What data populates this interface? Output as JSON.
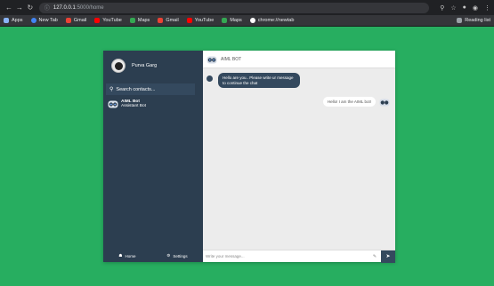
{
  "browser": {
    "url_host": "127.0.0.1",
    "url_path": ":5000/home",
    "bookmarks": [
      {
        "label": "Apps",
        "icon": "apps-grid-icon",
        "color": "#8ab4f8"
      },
      {
        "label": "New Tab",
        "icon": "chrome-icon",
        "color": "#4285f4"
      },
      {
        "label": "Gmail",
        "icon": "gmail-icon",
        "color": "#ea4335"
      },
      {
        "label": "YouTube",
        "icon": "youtube-icon",
        "color": "#ff0000"
      },
      {
        "label": "Maps",
        "icon": "maps-icon",
        "color": "#34a853"
      },
      {
        "label": "Gmail",
        "icon": "gmail-icon",
        "color": "#ea4335"
      },
      {
        "label": "YouTube",
        "icon": "youtube-icon",
        "color": "#ff0000"
      },
      {
        "label": "Maps",
        "icon": "maps-icon",
        "color": "#34a853"
      },
      {
        "label": "chrome://newtab",
        "icon": "github-icon",
        "color": "#ffffff"
      }
    ],
    "reading_list": "Reading list"
  },
  "sidebar": {
    "profile_name": "Purva Garg",
    "search_placeholder": "Search contacts...",
    "contact": {
      "name": "AIML Bot",
      "subtitle": "Assistant Bot"
    },
    "footer": {
      "home": "Home",
      "settings": "Settings"
    }
  },
  "chat": {
    "title": "AIML BOT",
    "incoming": "Hello are you.. Please write ur message to continue the chat",
    "outgoing": "Hello! I am the AIML bot!",
    "input_placeholder": "Write your message..."
  },
  "colors": {
    "background": "#27ae60",
    "sidebar": "#2c3e50",
    "accent": "#34495e"
  }
}
